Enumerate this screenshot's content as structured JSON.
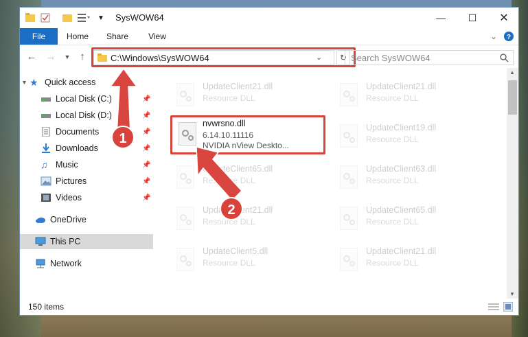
{
  "window": {
    "title": "SysWOW64"
  },
  "ribbon": {
    "tabs": [
      "File",
      "Home",
      "Share",
      "View"
    ]
  },
  "address": {
    "path": "C:\\Windows\\SysWOW64",
    "search_placeholder": "Search SysWOW64"
  },
  "nav": {
    "items": [
      {
        "label": "Quick access",
        "icon": "star-icon",
        "pinned": false
      },
      {
        "label": "Local Disk (C:)",
        "icon": "drive-icon",
        "pinned": true
      },
      {
        "label": "Local Disk (D:)",
        "icon": "drive-icon",
        "pinned": true
      },
      {
        "label": "Documents",
        "icon": "documents-icon",
        "pinned": true
      },
      {
        "label": "Downloads",
        "icon": "download-icon",
        "pinned": true
      },
      {
        "label": "Music",
        "icon": "music-icon",
        "pinned": true
      },
      {
        "label": "Pictures",
        "icon": "pictures-icon",
        "pinned": true
      },
      {
        "label": "Videos",
        "icon": "videos-icon",
        "pinned": true
      },
      {
        "label": "OneDrive",
        "icon": "cloud-icon",
        "pinned": false
      },
      {
        "label": "This PC",
        "icon": "computer-icon",
        "pinned": false
      },
      {
        "label": "Network",
        "icon": "network-icon",
        "pinned": false
      }
    ]
  },
  "files": {
    "left": [
      {
        "name": "UpdateClient21.dll",
        "desc": "Resource DLL"
      },
      {
        "name": "UpdateClient65.dll",
        "desc": "Resource DLL"
      },
      {
        "name": "UpdateClient21.dll",
        "desc": "Resource DLL"
      },
      {
        "name": "UpdateClient5.dll",
        "desc": "Resource DLL"
      }
    ],
    "right": [
      {
        "name": "UpdateClient21.dll",
        "desc": "Resource DLL"
      },
      {
        "name": "UpdateClient19.dll",
        "desc": "Resource DLL"
      },
      {
        "name": "UpdateClient63.dll",
        "desc": "Resource DLL"
      },
      {
        "name": "UpdateClient65.dll",
        "desc": "Resource DLL"
      },
      {
        "name": "UpdateClient21.dll",
        "desc": "Resource DLL"
      }
    ],
    "highlighted": {
      "name": "nvwrsno.dll",
      "version": "6.14.10.11116",
      "desc": "NVIDIA nView Deskto..."
    }
  },
  "status": {
    "count": "150 items"
  },
  "annotations": {
    "step1": "1",
    "step2": "2"
  },
  "colors": {
    "highlight": "#d9413b",
    "file_tab": "#1a6fc4"
  }
}
